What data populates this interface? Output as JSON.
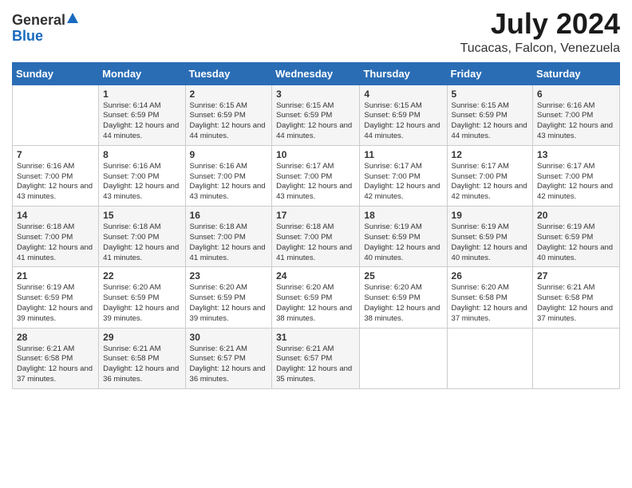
{
  "logo": {
    "general": "General",
    "blue": "Blue"
  },
  "header": {
    "month_year": "July 2024",
    "location": "Tucacas, Falcon, Venezuela"
  },
  "days_of_week": [
    "Sunday",
    "Monday",
    "Tuesday",
    "Wednesday",
    "Thursday",
    "Friday",
    "Saturday"
  ],
  "weeks": [
    [
      {
        "day": "",
        "info": ""
      },
      {
        "day": "1",
        "info": "Sunrise: 6:14 AM\nSunset: 6:59 PM\nDaylight: 12 hours and 44 minutes."
      },
      {
        "day": "2",
        "info": "Sunrise: 6:15 AM\nSunset: 6:59 PM\nDaylight: 12 hours and 44 minutes."
      },
      {
        "day": "3",
        "info": "Sunrise: 6:15 AM\nSunset: 6:59 PM\nDaylight: 12 hours and 44 minutes."
      },
      {
        "day": "4",
        "info": "Sunrise: 6:15 AM\nSunset: 6:59 PM\nDaylight: 12 hours and 44 minutes."
      },
      {
        "day": "5",
        "info": "Sunrise: 6:15 AM\nSunset: 6:59 PM\nDaylight: 12 hours and 44 minutes."
      },
      {
        "day": "6",
        "info": "Sunrise: 6:16 AM\nSunset: 7:00 PM\nDaylight: 12 hours and 43 minutes."
      }
    ],
    [
      {
        "day": "7",
        "info": "Sunrise: 6:16 AM\nSunset: 7:00 PM\nDaylight: 12 hours and 43 minutes."
      },
      {
        "day": "8",
        "info": "Sunrise: 6:16 AM\nSunset: 7:00 PM\nDaylight: 12 hours and 43 minutes."
      },
      {
        "day": "9",
        "info": "Sunrise: 6:16 AM\nSunset: 7:00 PM\nDaylight: 12 hours and 43 minutes."
      },
      {
        "day": "10",
        "info": "Sunrise: 6:17 AM\nSunset: 7:00 PM\nDaylight: 12 hours and 43 minutes."
      },
      {
        "day": "11",
        "info": "Sunrise: 6:17 AM\nSunset: 7:00 PM\nDaylight: 12 hours and 42 minutes."
      },
      {
        "day": "12",
        "info": "Sunrise: 6:17 AM\nSunset: 7:00 PM\nDaylight: 12 hours and 42 minutes."
      },
      {
        "day": "13",
        "info": "Sunrise: 6:17 AM\nSunset: 7:00 PM\nDaylight: 12 hours and 42 minutes."
      }
    ],
    [
      {
        "day": "14",
        "info": "Sunrise: 6:18 AM\nSunset: 7:00 PM\nDaylight: 12 hours and 41 minutes."
      },
      {
        "day": "15",
        "info": "Sunrise: 6:18 AM\nSunset: 7:00 PM\nDaylight: 12 hours and 41 minutes."
      },
      {
        "day": "16",
        "info": "Sunrise: 6:18 AM\nSunset: 7:00 PM\nDaylight: 12 hours and 41 minutes."
      },
      {
        "day": "17",
        "info": "Sunrise: 6:18 AM\nSunset: 7:00 PM\nDaylight: 12 hours and 41 minutes."
      },
      {
        "day": "18",
        "info": "Sunrise: 6:19 AM\nSunset: 6:59 PM\nDaylight: 12 hours and 40 minutes."
      },
      {
        "day": "19",
        "info": "Sunrise: 6:19 AM\nSunset: 6:59 PM\nDaylight: 12 hours and 40 minutes."
      },
      {
        "day": "20",
        "info": "Sunrise: 6:19 AM\nSunset: 6:59 PM\nDaylight: 12 hours and 40 minutes."
      }
    ],
    [
      {
        "day": "21",
        "info": "Sunrise: 6:19 AM\nSunset: 6:59 PM\nDaylight: 12 hours and 39 minutes."
      },
      {
        "day": "22",
        "info": "Sunrise: 6:20 AM\nSunset: 6:59 PM\nDaylight: 12 hours and 39 minutes."
      },
      {
        "day": "23",
        "info": "Sunrise: 6:20 AM\nSunset: 6:59 PM\nDaylight: 12 hours and 39 minutes."
      },
      {
        "day": "24",
        "info": "Sunrise: 6:20 AM\nSunset: 6:59 PM\nDaylight: 12 hours and 38 minutes."
      },
      {
        "day": "25",
        "info": "Sunrise: 6:20 AM\nSunset: 6:59 PM\nDaylight: 12 hours and 38 minutes."
      },
      {
        "day": "26",
        "info": "Sunrise: 6:20 AM\nSunset: 6:58 PM\nDaylight: 12 hours and 37 minutes."
      },
      {
        "day": "27",
        "info": "Sunrise: 6:21 AM\nSunset: 6:58 PM\nDaylight: 12 hours and 37 minutes."
      }
    ],
    [
      {
        "day": "28",
        "info": "Sunrise: 6:21 AM\nSunset: 6:58 PM\nDaylight: 12 hours and 37 minutes."
      },
      {
        "day": "29",
        "info": "Sunrise: 6:21 AM\nSunset: 6:58 PM\nDaylight: 12 hours and 36 minutes."
      },
      {
        "day": "30",
        "info": "Sunrise: 6:21 AM\nSunset: 6:57 PM\nDaylight: 12 hours and 36 minutes."
      },
      {
        "day": "31",
        "info": "Sunrise: 6:21 AM\nSunset: 6:57 PM\nDaylight: 12 hours and 35 minutes."
      },
      {
        "day": "",
        "info": ""
      },
      {
        "day": "",
        "info": ""
      },
      {
        "day": "",
        "info": ""
      }
    ]
  ]
}
